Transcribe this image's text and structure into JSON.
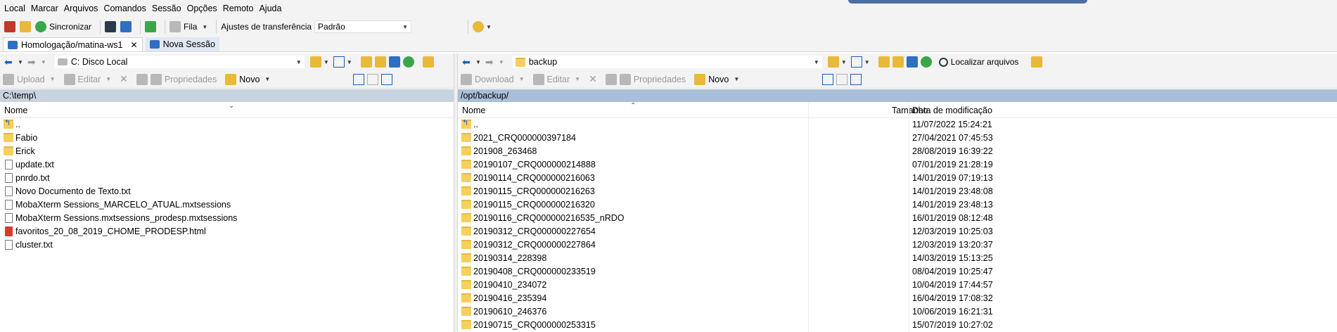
{
  "menu": [
    "Local",
    "Marcar",
    "Arquivos",
    "Comandos",
    "Sessão",
    "Opções",
    "Remoto",
    "Ajuda"
  ],
  "toolbar": {
    "sync_label": "Sincronizar",
    "queue_label": "Fila",
    "transfer_settings_label": "Ajustes de transferência",
    "transfer_settings_value": "Padrão"
  },
  "tabs": [
    {
      "label": "Homologação/matina-ws1",
      "active": true
    },
    {
      "label": "Nova Sessão",
      "active": false
    }
  ],
  "left": {
    "drive": "C: Disco Local",
    "actions": {
      "upload": "Upload",
      "edit": "Editar",
      "properties": "Propriedades",
      "new": "Novo"
    },
    "path": "C:\\temp\\",
    "columns": {
      "name": "Nome"
    },
    "files": [
      {
        "name": "..",
        "icon": "up-folder-icon"
      },
      {
        "name": "Fabio",
        "icon": "folder-icon"
      },
      {
        "name": "Erick",
        "icon": "folder-icon"
      },
      {
        "name": "update.txt",
        "icon": "file-icon"
      },
      {
        "name": "pnrdo.txt",
        "icon": "file-icon"
      },
      {
        "name": "Novo Documento de Texto.txt",
        "icon": "file-icon"
      },
      {
        "name": "MobaXterm Sessions_MARCELO_ATUAL.mxtsessions",
        "icon": "file-icon"
      },
      {
        "name": "MobaXterm Sessions.mxtsessions_prodesp.mxtsessions",
        "icon": "file-icon"
      },
      {
        "name": "favoritos_20_08_2019_CHOME_PRODESP.html",
        "icon": "html-file-icon"
      },
      {
        "name": "cluster.txt",
        "icon": "file-icon"
      }
    ]
  },
  "right": {
    "folder": "backup",
    "find_files_label": "Localizar arquivos",
    "actions": {
      "download": "Download",
      "edit": "Editar",
      "properties": "Propriedades",
      "new": "Novo"
    },
    "path": "/opt/backup/",
    "columns": {
      "name": "Nome",
      "size": "Tamanho",
      "modified": "Data de modificação"
    },
    "files": [
      {
        "name": "..",
        "date": "11/07/2022 15:24:21",
        "icon": "up-folder-icon"
      },
      {
        "name": "2021_CRQ000000397184",
        "date": "27/04/2021 07:45:53",
        "icon": "folder-icon"
      },
      {
        "name": "201908_263468",
        "date": "28/08/2019 16:39:22",
        "icon": "folder-icon"
      },
      {
        "name": "20190107_CRQ000000214888",
        "date": "07/01/2019 21:28:19",
        "icon": "folder-icon"
      },
      {
        "name": "20190114_CRQ000000216063",
        "date": "14/01/2019 07:19:13",
        "icon": "folder-icon"
      },
      {
        "name": "20190115_CRQ000000216263",
        "date": "14/01/2019 23:48:08",
        "icon": "folder-icon"
      },
      {
        "name": "20190115_CRQ000000216320",
        "date": "14/01/2019 23:48:13",
        "icon": "folder-icon"
      },
      {
        "name": "20190116_CRQ000000216535_nRDO",
        "date": "16/01/2019 08:12:48",
        "icon": "folder-icon"
      },
      {
        "name": "20190312_CRQ000000227654",
        "date": "12/03/2019 10:25:03",
        "icon": "folder-icon"
      },
      {
        "name": "20190312_CRQ000000227864",
        "date": "12/03/2019 13:20:37",
        "icon": "folder-icon"
      },
      {
        "name": "20190314_228398",
        "date": "14/03/2019 15:13:25",
        "icon": "folder-icon"
      },
      {
        "name": "20190408_CRQ000000233519",
        "date": "08/04/2019 10:25:47",
        "icon": "folder-icon"
      },
      {
        "name": "20190410_234072",
        "date": "10/04/2019 17:44:57",
        "icon": "folder-icon"
      },
      {
        "name": "20190416_235394",
        "date": "16/04/2019 17:08:32",
        "icon": "folder-icon"
      },
      {
        "name": "20190610_246376",
        "date": "10/06/2019 16:21:31",
        "icon": "folder-icon"
      },
      {
        "name": "20190715_CRQ000000253315",
        "date": "15/07/2019 10:27:02",
        "icon": "folder-icon"
      }
    ]
  }
}
